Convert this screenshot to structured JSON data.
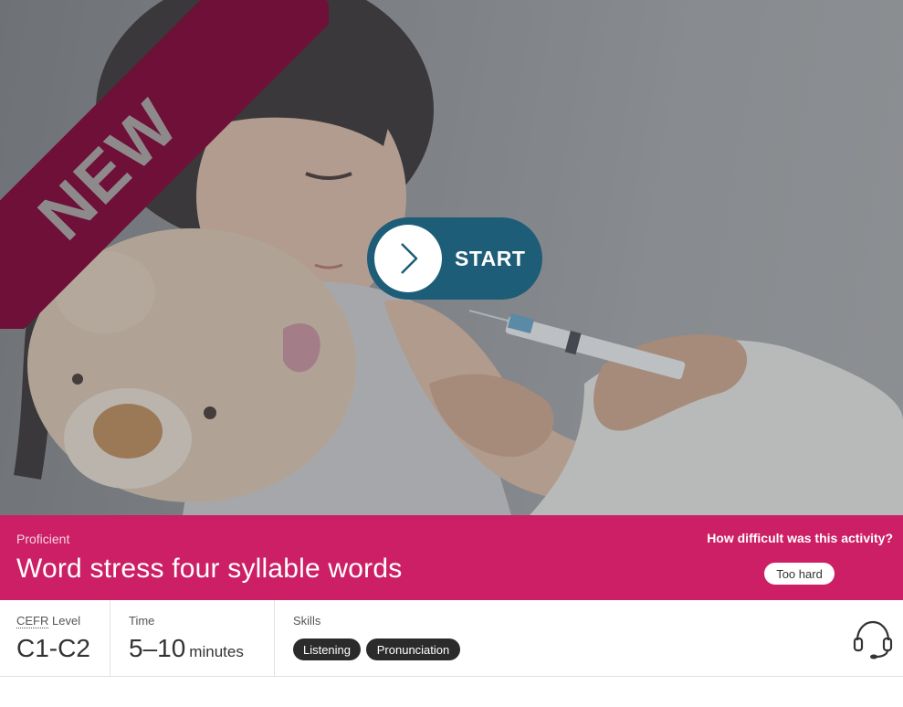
{
  "hero": {
    "ribbon_text": "NEW",
    "start_label": "START",
    "icons": {
      "start": "chevron-right-icon"
    }
  },
  "activity": {
    "level_name": "Proficient",
    "title": "Word stress four syllable words",
    "difficulty_question": "How difficult was this activity?",
    "difficulty_option": "Too hard"
  },
  "info": {
    "cefr_abbr": "CEFR",
    "cefr_label_rest": " Level",
    "cefr_value": "C1-C2",
    "time_label": "Time",
    "time_value": "5–10",
    "time_unit": "minutes",
    "skills_label": "Skills",
    "skills": [
      "Listening",
      "Pronunciation"
    ],
    "support_icon": "headset-icon"
  },
  "colors": {
    "brand_pink": "#cc1f65",
    "ribbon": "#6e1038",
    "start_button": "#1d5d78",
    "chip": "#2b2b2b"
  }
}
